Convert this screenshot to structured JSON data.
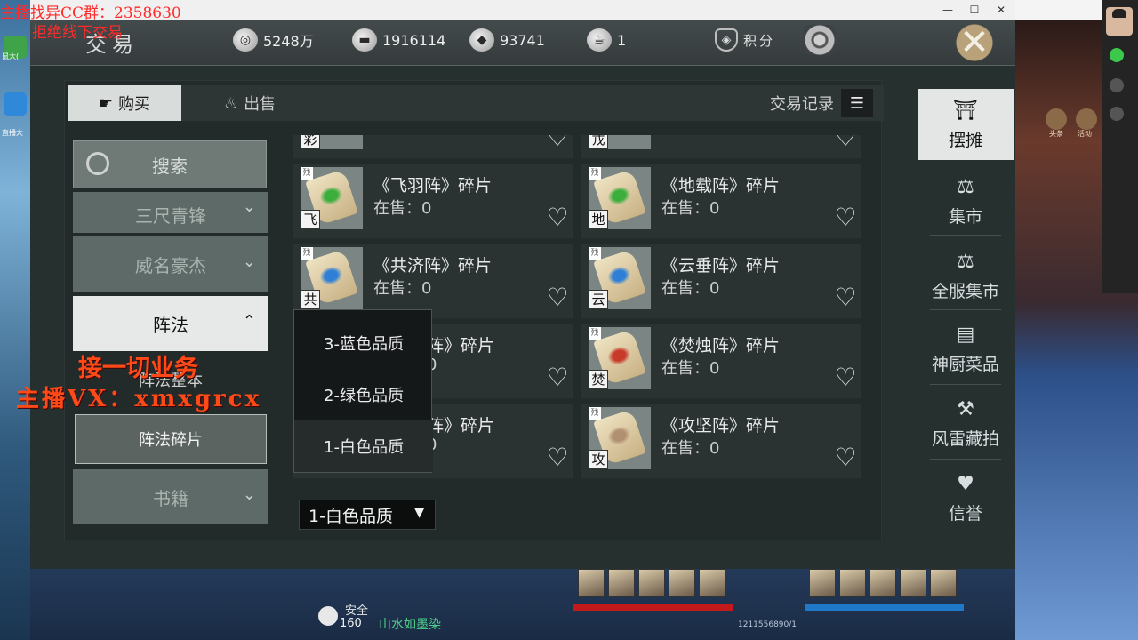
{
  "stream_overlay": {
    "qq_group": "主播找异CC群：2358630",
    "notice": "拒绝线下交易",
    "ad_line1": "接一切业务",
    "ad_line2": "主播VX：xmxgrcx"
  },
  "desktop": {
    "icon_labels": [
      "鼠大(",
      "直播大"
    ]
  },
  "window": {
    "minimize": "—",
    "maximize": "☐",
    "close": "✕"
  },
  "game_top_icons": [
    "头条",
    "活动"
  ],
  "header": {
    "title": "交易",
    "currencies": [
      {
        "icon": "coin-icon",
        "value": "5248万"
      },
      {
        "icon": "ingot-icon",
        "value": "1916114"
      },
      {
        "icon": "ticket-icon",
        "value": "93741"
      },
      {
        "icon": "tea-icon",
        "value": "1"
      }
    ],
    "points_label": "积分"
  },
  "tabs": {
    "buy": "购买",
    "sell": "出售",
    "history": "交易记录"
  },
  "left": {
    "search": "搜索",
    "categories": [
      {
        "label": "三尺青锋",
        "state": "collapsed"
      },
      {
        "label": "威名豪杰",
        "state": "collapsed"
      },
      {
        "label": "阵法",
        "state": "expanded"
      }
    ],
    "subitems": [
      "阵法整本",
      "阵法碎片"
    ],
    "bottom_category": "书籍"
  },
  "items": [
    {
      "name": "《飞羽阵》碎片",
      "stock": "在售：0",
      "badge": "飞",
      "color": "#3cae3c"
    },
    {
      "name": "《地载阵》碎片",
      "stock": "在售：0",
      "badge": "地",
      "color": "#3cae3c"
    },
    {
      "name": "《共济阵》碎片",
      "stock": "在售：0",
      "badge": "共",
      "color": "#2f7fd6"
    },
    {
      "name": "《云垂阵》碎片",
      "stock": "在售：0",
      "badge": "云",
      "color": "#2f7fd6"
    },
    {
      "name": "阵》碎片",
      "stock": "0",
      "badge": "",
      "color": "#c83a2a"
    },
    {
      "name": "《焚烛阵》碎片",
      "stock": "在售：0",
      "badge": "焚",
      "color": "#c83a2a"
    },
    {
      "name": "阵》碎片",
      "stock": "0",
      "badge": "",
      "color": "#b09070"
    },
    {
      "name": "《攻坚阵》碎片",
      "stock": "在售：0",
      "badge": "攻",
      "color": "#b09070"
    }
  ],
  "partial_top_badges": [
    "彩",
    "戎"
  ],
  "quality_filter": {
    "options": [
      "3-蓝色品质",
      "2-绿色品质",
      "1-白色品质"
    ],
    "selected": "1-白色品质"
  },
  "nav": [
    "摆摊",
    "集市",
    "全服集市",
    "神厨菜品",
    "风雷藏拍",
    "信誉"
  ],
  "hud": {
    "safety": "安全",
    "level": "160",
    "map": "山水如墨染",
    "player_id": "1211556890/1"
  }
}
